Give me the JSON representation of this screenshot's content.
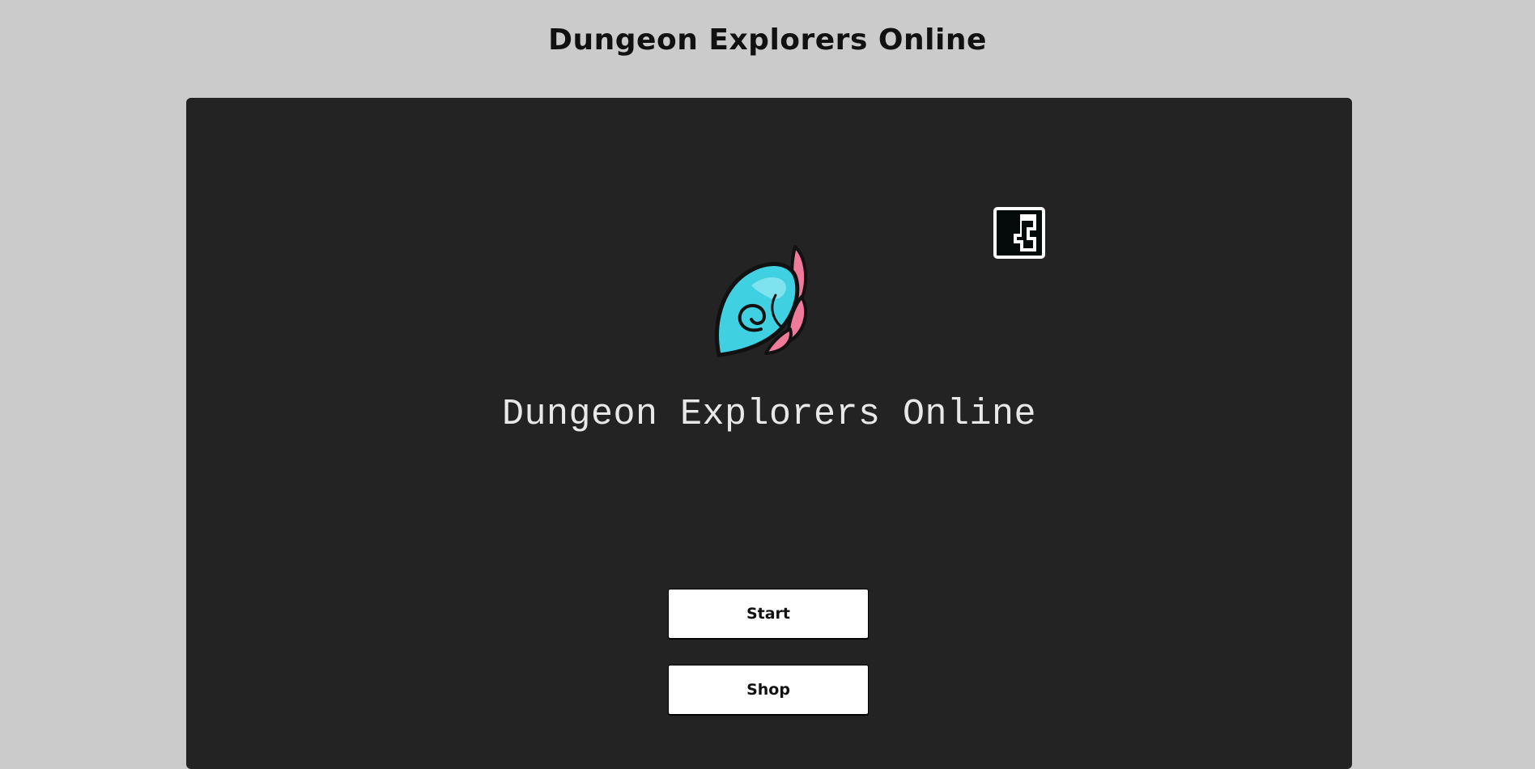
{
  "page": {
    "header_title": "Dungeon Explorers Online"
  },
  "game": {
    "title": "Dungeon Explorers Online",
    "logo_icon": "feather-emblem-icon",
    "corner_icon": "puzzle-piece-icon",
    "menu": {
      "start_label": "Start",
      "shop_label": "Shop"
    }
  },
  "colors": {
    "page_background": "#cbcbcb",
    "panel_background": "#232323",
    "title_text": "#e8e8e8",
    "feather_cyan": "#3fd0e2",
    "feather_pink": "#f07a9a",
    "button_background": "#ffffff"
  }
}
